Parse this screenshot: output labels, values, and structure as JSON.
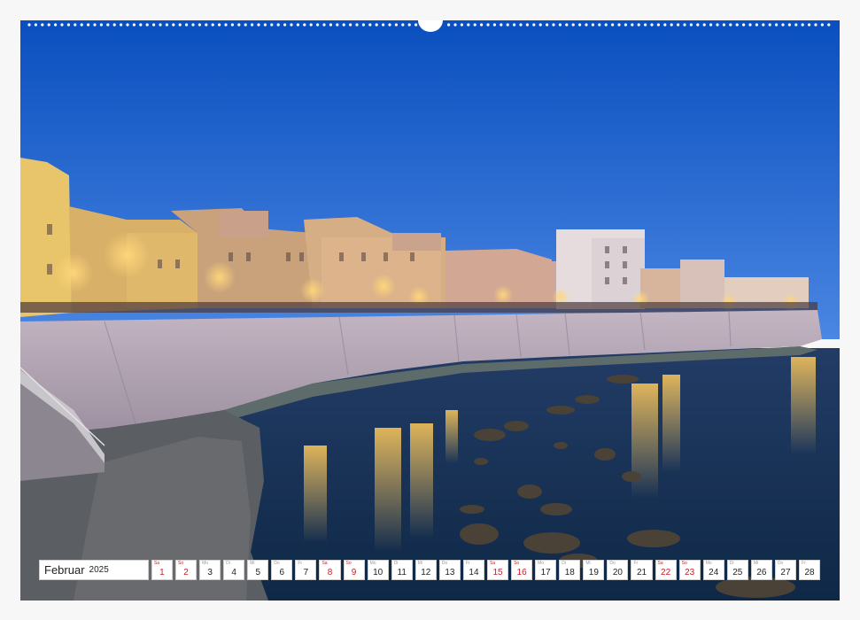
{
  "calendar": {
    "month": "Februar",
    "year": "2025",
    "days": [
      {
        "n": "1",
        "w": "Sa",
        "red": true
      },
      {
        "n": "2",
        "w": "So",
        "red": true
      },
      {
        "n": "3",
        "w": "Mo",
        "red": false
      },
      {
        "n": "4",
        "w": "Di",
        "red": false
      },
      {
        "n": "5",
        "w": "Mi",
        "red": false
      },
      {
        "n": "6",
        "w": "Do",
        "red": false
      },
      {
        "n": "7",
        "w": "Fr",
        "red": false
      },
      {
        "n": "8",
        "w": "Sa",
        "red": true
      },
      {
        "n": "9",
        "w": "So",
        "red": true
      },
      {
        "n": "10",
        "w": "Mo",
        "red": false
      },
      {
        "n": "11",
        "w": "Di",
        "red": false
      },
      {
        "n": "12",
        "w": "Mi",
        "red": false
      },
      {
        "n": "13",
        "w": "Do",
        "red": false
      },
      {
        "n": "14",
        "w": "Fr",
        "red": false
      },
      {
        "n": "15",
        "w": "Sa",
        "red": true
      },
      {
        "n": "16",
        "w": "So",
        "red": true
      },
      {
        "n": "17",
        "w": "Mo",
        "red": false
      },
      {
        "n": "18",
        "w": "Di",
        "red": false
      },
      {
        "n": "19",
        "w": "Mi",
        "red": false
      },
      {
        "n": "20",
        "w": "Do",
        "red": false
      },
      {
        "n": "21",
        "w": "Fr",
        "red": false
      },
      {
        "n": "22",
        "w": "Sa",
        "red": true
      },
      {
        "n": "23",
        "w": "So",
        "red": true
      },
      {
        "n": "24",
        "w": "Mo",
        "red": false
      },
      {
        "n": "25",
        "w": "Di",
        "red": false
      },
      {
        "n": "26",
        "w": "Mi",
        "red": false
      },
      {
        "n": "27",
        "w": "Do",
        "red": false
      },
      {
        "n": "28",
        "w": "Fr",
        "red": false
      }
    ]
  },
  "colors": {
    "sky_top": "#0a4fbf",
    "sky_bottom": "#3f7fe0",
    "wall": "#b7a9b8",
    "water": "#16385e",
    "light": "#f5c04a",
    "weekend": "#c8202a"
  }
}
